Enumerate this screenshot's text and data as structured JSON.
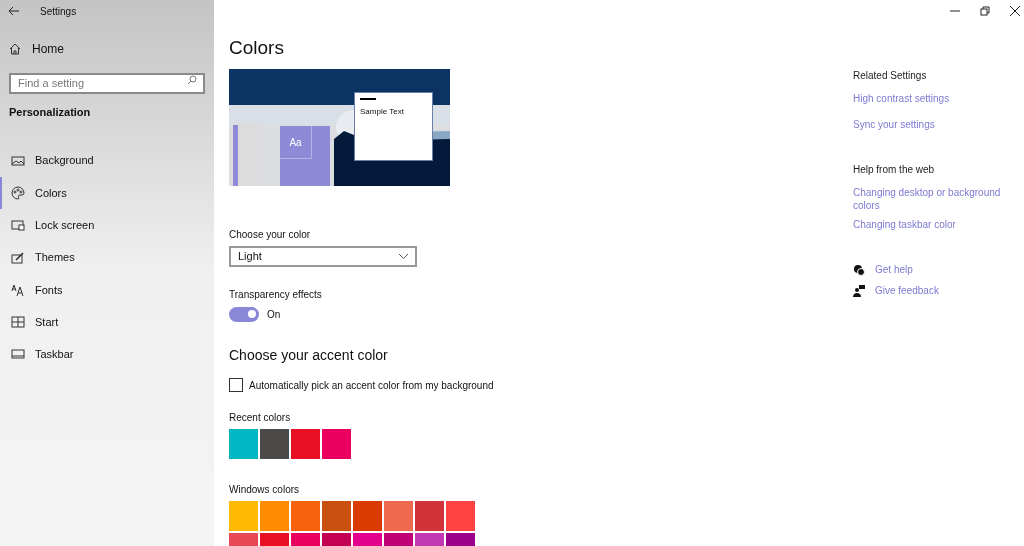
{
  "window": {
    "title": "Settings"
  },
  "sidebar": {
    "home": "Home",
    "search": {
      "placeholder": "Find a setting"
    },
    "section": "Personalization",
    "items": [
      {
        "label": "Background",
        "selected": false
      },
      {
        "label": "Colors",
        "selected": true
      },
      {
        "label": "Lock screen",
        "selected": false
      },
      {
        "label": "Themes",
        "selected": false
      },
      {
        "label": "Fonts",
        "selected": false
      },
      {
        "label": "Start",
        "selected": false
      },
      {
        "label": "Taskbar",
        "selected": false
      }
    ]
  },
  "page": {
    "title": "Colors",
    "preview": {
      "sample_text": "Sample Text",
      "tile_text": "Aa"
    },
    "choose_color": {
      "label": "Choose your color",
      "value": "Light"
    },
    "transparency": {
      "label": "Transparency effects",
      "on": true,
      "state_text": "On"
    },
    "accent_heading": "Choose your accent color",
    "auto_pick": {
      "label": "Automatically pick an accent color from my background",
      "checked": false
    },
    "recent": {
      "label": "Recent colors",
      "swatches": [
        {
          "color": "#00b7c3"
        },
        {
          "color": "#4c4a48"
        },
        {
          "color": "#e81123"
        },
        {
          "color": "#ea005e"
        }
      ]
    },
    "windows": {
      "label": "Windows colors",
      "swatches": [
        {
          "color": "#ffb900"
        },
        {
          "color": "#ff8c00"
        },
        {
          "color": "#f7630c"
        },
        {
          "color": "#ca5010"
        },
        {
          "color": "#da3b01"
        },
        {
          "color": "#ef6950"
        },
        {
          "color": "#d13438"
        },
        {
          "color": "#ff4343"
        },
        {
          "color": "#e74856"
        },
        {
          "color": "#e81123"
        },
        {
          "color": "#ea005e"
        },
        {
          "color": "#c30052"
        },
        {
          "color": "#e3008c"
        },
        {
          "color": "#bf0077"
        },
        {
          "color": "#c239b3"
        },
        {
          "color": "#9a0089"
        }
      ]
    }
  },
  "aside": {
    "sections": [
      {
        "heading": "Related Settings",
        "links": [
          "High contrast settings",
          "Sync your settings"
        ]
      },
      {
        "heading": "Help from the web",
        "links": [
          "Changing desktop or background colors",
          "Changing taskbar color"
        ]
      }
    ],
    "actions": [
      {
        "label": "Get help"
      },
      {
        "label": "Give feedback"
      }
    ]
  }
}
